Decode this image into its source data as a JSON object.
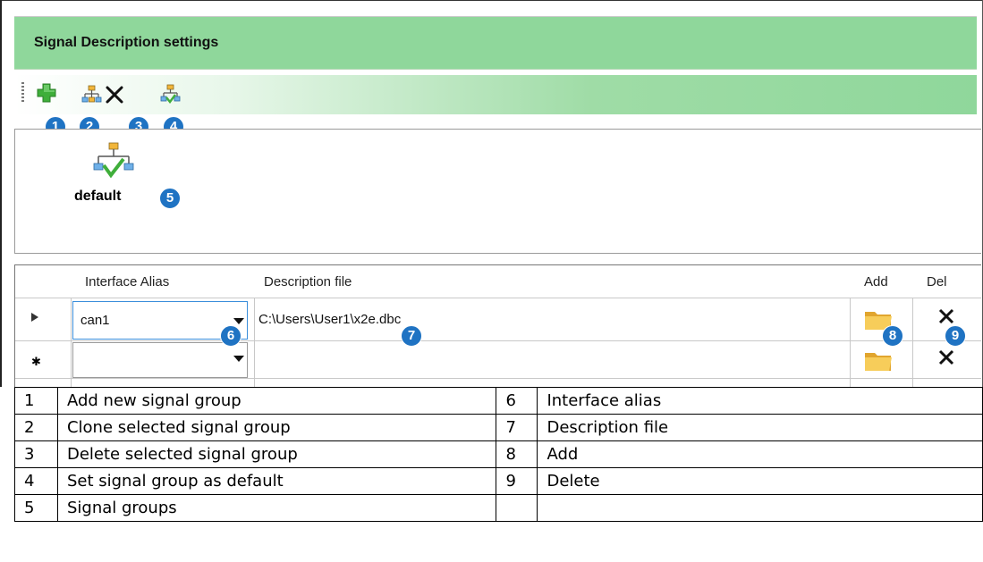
{
  "window": {
    "title": "Signal Description settings"
  },
  "toolbar": {
    "buttons": [
      {
        "icon": "add-green-plus-icon",
        "badge": "1"
      },
      {
        "icon": "clone-hierarchy-icon",
        "badge": "2"
      },
      {
        "icon": "delete-x-icon",
        "badge": "3"
      },
      {
        "icon": "set-default-hierarchy-icon",
        "badge": "4"
      }
    ]
  },
  "groups": {
    "items": [
      {
        "label": "default",
        "icon": "default-group-check-icon",
        "badge": "5"
      }
    ]
  },
  "grid": {
    "columns": [
      "Interface Alias",
      "Description file",
      "Add",
      "Del"
    ],
    "rows": [
      {
        "alias": "can1",
        "file": "C:\\Users\\User1\\x2e.dbc"
      },
      {
        "alias": "",
        "file": ""
      }
    ],
    "badges": {
      "alias": "6",
      "file": "7",
      "add": "8",
      "del": "9"
    }
  },
  "legend": {
    "rows": [
      [
        "1",
        "Add new signal group",
        "6",
        "Interface alias"
      ],
      [
        "2",
        "Clone selected signal group",
        "7",
        "Description file"
      ],
      [
        "3",
        "Delete selected signal group",
        "8",
        "Add"
      ],
      [
        "4",
        "Set signal group as default",
        "9",
        "Delete"
      ],
      [
        "5",
        "Signal groups",
        "",
        ""
      ]
    ]
  },
  "colors": {
    "header_green": "#8fd79b",
    "badge_blue": "#1f73c3",
    "folder_yellow": "#f5c542"
  }
}
